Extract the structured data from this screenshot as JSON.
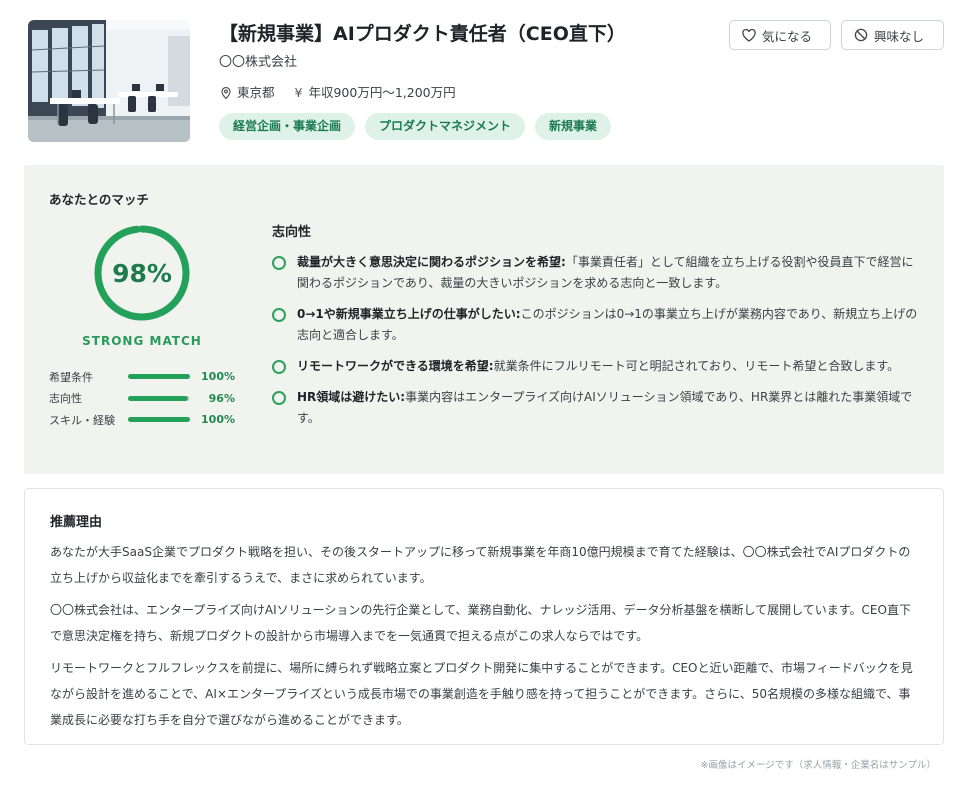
{
  "job": {
    "title": "【新規事業】AIプロダクト責任者（CEO直下）",
    "company": "〇〇株式会社",
    "location": "東京都",
    "salary_icon": "¥",
    "salary": "年収900万円〜1,200万円",
    "tags": [
      "経営企画・事業企画",
      "プロダクトマネジメント",
      "新規事業"
    ]
  },
  "actions": {
    "like_label": "気になる",
    "not_interested_label": "興味なし"
  },
  "match": {
    "title": "あなたとのマッチ",
    "percent_label": "98%",
    "percent": 98,
    "level": "STRONG MATCH",
    "bars": [
      {
        "label": "希望条件",
        "value": 100,
        "value_label": "100%"
      },
      {
        "label": "志向性",
        "value": 96,
        "value_label": "96%"
      },
      {
        "label": "スキル・経験",
        "value": 100,
        "value_label": "100%"
      }
    ],
    "section_title": "志向性",
    "reasons": [
      {
        "head": "裁量が大きく意思決定に関わるポジションを希望:",
        "text": "「事業責任者」として組織を立ち上げる役割や役員直下で経営に関わるポジションであり、裁量の大きいポジションを求める志向と一致します。"
      },
      {
        "head": "0→1や新規事業立ち上げの仕事がしたい:",
        "text": "このポジションは0→1の事業立ち上げが業務内容であり、新規立ち上げの志向と適合します。"
      },
      {
        "head": "リモートワークができる環境を希望:",
        "text": "就業条件にフルリモート可と明記されており、リモート希望と合致します。"
      },
      {
        "head": "HR領域は避けたい:",
        "text": "事業内容はエンタープライズ向けAIソリューション領域であり、HR業界とは離れた事業領域です。"
      }
    ]
  },
  "recommendation": {
    "title": "推薦理由",
    "paragraphs": [
      "あなたが大手SaaS企業でプロダクト戦略を担い、その後スタートアップに移って新規事業を年商10億円規模まで育てた経験は、〇〇株式会社でAIプロダクトの立ち上げから収益化までを牽引するうえで、まさに求められています。",
      "〇〇株式会社は、エンタープライズ向けAIソリューションの先行企業として、業務自動化、ナレッジ活用、データ分析基盤を横断して展開しています。CEO直下で意思決定権を持ち、新規プロダクトの設計から市場導入までを一気通貫で担える点がこの求人ならではです。",
      "リモートワークとフルフレックスを前提に、場所に縛られず戦略立案とプロダクト開発に集中することができます。CEOと近い距離で、市場フィードバックを見ながら設計を進めることで、AI×エンタープライズという成長市場での事業創造を手触り感を持って担うことができます。さらに、50名規模の多様な組織で、事業成長に必要な打ち手を自分で選びながら進めることができます。"
    ]
  },
  "footnote": "※画像はイメージです（求人情報・企業名はサンプル）",
  "colors": {
    "accent": "#23a05a",
    "tag_bg": "#dff2ea",
    "panel_bg": "#f1f4ee"
  }
}
